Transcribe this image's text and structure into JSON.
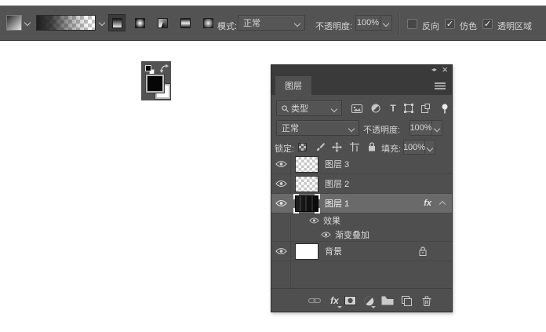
{
  "options_bar": {
    "mode_label": "模式:",
    "mode_value": "正常",
    "opacity_label": "不透明度:",
    "opacity_value": "100%",
    "reverse_label": "反向",
    "dither_label": "仿色",
    "transparency_label": "透明区域",
    "reverse_checked": false,
    "dither_checked": true,
    "transparency_checked": true,
    "check_glyph": "✓",
    "gradient_types": [
      "linear",
      "radial",
      "angle",
      "reflected",
      "diamond"
    ],
    "selected_gradient_type": "linear"
  },
  "color_widget": {
    "foreground_color": "#000000",
    "background_color": "#ffffff"
  },
  "layers_panel": {
    "tab_label": "图层",
    "collapse_glyph": "◂▸",
    "close_glyph": "×",
    "filter_kind_label": "类型",
    "blend_mode_value": "正常",
    "opacity_label": "不透明度:",
    "opacity_value": "100%",
    "lock_label": "锁定:",
    "fill_label": "填充:",
    "fill_value": "100%",
    "fx_badge": "fx",
    "bottom_fx_label": "fx",
    "layers": [
      {
        "label": "图层 3",
        "visible": true,
        "thumb": "transparent-checker",
        "selected": false
      },
      {
        "label": "图层 2",
        "visible": true,
        "thumb": "transparent-checker",
        "selected": false
      },
      {
        "label": "图层 1",
        "visible": true,
        "thumb": "dark-gradient",
        "selected": true,
        "has_fx": true
      },
      {
        "label": "效果",
        "visible": true,
        "row_type": "effects-header"
      },
      {
        "label": "渐变叠加",
        "visible": true,
        "row_type": "effect-item"
      },
      {
        "label": "背景",
        "visible": true,
        "thumb": "white",
        "locked": true,
        "selected": false
      }
    ]
  },
  "colors": {
    "bar_bg": "#535353",
    "panel_bg": "#4f4f4f",
    "selected_row": "#6a6a6a",
    "header_bg": "#3a3a3a"
  }
}
